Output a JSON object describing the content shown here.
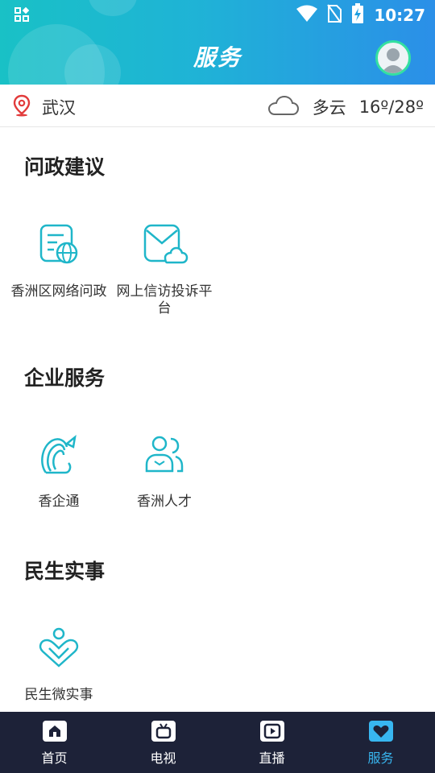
{
  "status_bar": {
    "time": "10:27"
  },
  "header": {
    "title": "服务"
  },
  "location": {
    "city": "武汉",
    "weather": "多云",
    "temperature": "16º/28º"
  },
  "sections": [
    {
      "title": "问政建议",
      "items": [
        {
          "label": "香洲区网络问政",
          "icon": "web-document-icon"
        },
        {
          "label": "网上信访投诉平台",
          "icon": "mail-cloud-icon"
        }
      ]
    },
    {
      "title": "企业服务",
      "items": [
        {
          "label": "香企通",
          "icon": "shell-logo-icon"
        },
        {
          "label": "香洲人才",
          "icon": "people-icon"
        }
      ]
    },
    {
      "title": "民生实事",
      "items": [
        {
          "label": "民生微实事",
          "icon": "heart-person-icon"
        }
      ]
    }
  ],
  "tabs": [
    {
      "label": "首页",
      "icon": "home-icon",
      "active": false
    },
    {
      "label": "电视",
      "icon": "tv-icon",
      "active": false
    },
    {
      "label": "直播",
      "icon": "play-icon",
      "active": false
    },
    {
      "label": "服务",
      "icon": "heart-icon",
      "active": true
    }
  ],
  "colors": {
    "accent": "#1fb6c9",
    "tab_active": "#38b6f0",
    "tabbar_bg": "#1d2238"
  }
}
